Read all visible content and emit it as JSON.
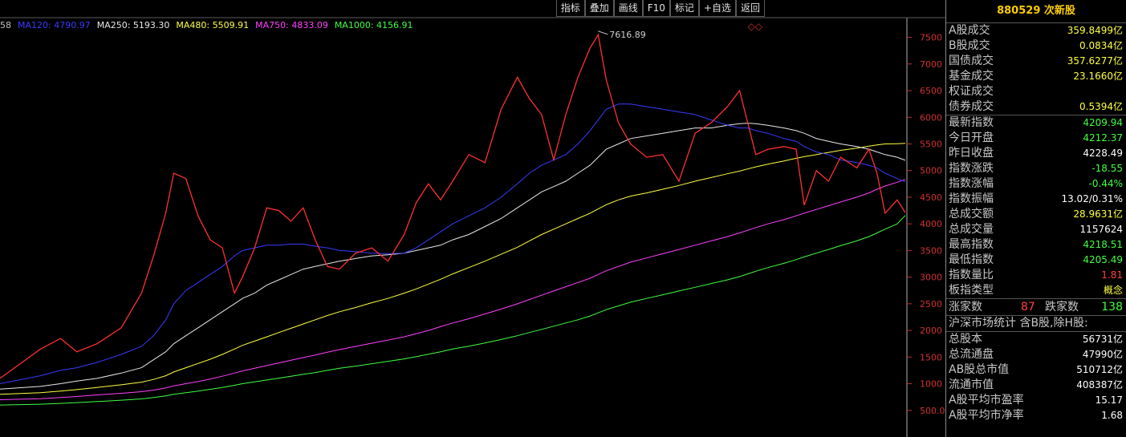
{
  "toolbar": {
    "buttons": [
      "指标",
      "叠加",
      "画线",
      "F10",
      "标记",
      "+自选",
      "返回"
    ]
  },
  "ma_legend": [
    {
      "text": "58",
      "color": "#c0c0c0"
    },
    {
      "text": "MA120: 4790.97",
      "color": "#3a3aff"
    },
    {
      "text": "MA250: 5193.30",
      "color": "#e8e8e8"
    },
    {
      "text": "MA480: 5509.91",
      "color": "#ffff40"
    },
    {
      "text": "MA750: 4833.09",
      "color": "#ff40ff"
    },
    {
      "text": "MA1000: 4156.91",
      "color": "#40ff40"
    }
  ],
  "panel": {
    "title": "880529 次新股",
    "rows_a": [
      {
        "label": "A股成交",
        "value": "359.8499亿",
        "color": "#ffff40"
      },
      {
        "label": "B股成交",
        "value": "0.0834亿",
        "color": "#ffff40"
      },
      {
        "label": "国债成交",
        "value": "357.6277亿",
        "color": "#ffff40"
      },
      {
        "label": "基金成交",
        "value": "23.1660亿",
        "color": "#ffff40"
      },
      {
        "label": "权证成交",
        "value": "",
        "color": "#ffff40"
      },
      {
        "label": "债券成交",
        "value": "0.5394亿",
        "color": "#ffff40"
      }
    ],
    "rows_b": [
      {
        "label": "最新指数",
        "value": "4209.94",
        "color": "#40ff40"
      },
      {
        "label": "今日开盘",
        "value": "4212.37",
        "color": "#40ff40"
      },
      {
        "label": "昨日收盘",
        "value": "4228.49",
        "color": "#ffffff"
      },
      {
        "label": "指数涨跌",
        "value": "-18.55",
        "color": "#40ff40"
      },
      {
        "label": "指数涨幅",
        "value": "-0.44%",
        "color": "#40ff40"
      },
      {
        "label": "指数振幅",
        "value": "13.02/0.31%",
        "color": "#ffffff"
      },
      {
        "label": "总成交额",
        "value": "28.9631亿",
        "color": "#ffff40"
      },
      {
        "label": "总成交量",
        "value": "1157624",
        "color": "#ffffff"
      },
      {
        "label": "最高指数",
        "value": "4218.51",
        "color": "#40ff40"
      },
      {
        "label": "最低指数",
        "value": "4205.49",
        "color": "#40ff40"
      },
      {
        "label": "指数量比",
        "value": "1.81",
        "color": "#ff4040"
      },
      {
        "label": "板指类型",
        "value": "概念",
        "color": "#ffff40"
      }
    ],
    "stats": {
      "up_label": "涨家数",
      "up_value": "87",
      "down_label": "跌家数",
      "down_value": "138"
    },
    "scope_label": "沪深市场统计 含B股,除H股:",
    "rows_c": [
      {
        "label": "总股本",
        "value": "56731亿",
        "color": "#ffffff"
      },
      {
        "label": "总流通盘",
        "value": "47990亿",
        "color": "#ffffff"
      },
      {
        "label": "AB股总市值",
        "value": "510712亿",
        "color": "#ffffff"
      },
      {
        "label": "流通市值",
        "value": "408387亿",
        "color": "#ffffff"
      },
      {
        "label": "A股平均市盈率",
        "value": "15.17",
        "color": "#ffffff"
      },
      {
        "label": "A股平均市净率",
        "value": "1.68",
        "color": "#ffffff"
      }
    ]
  },
  "chart_data": {
    "type": "line",
    "ylim": [
      0,
      7900
    ],
    "y_ticks": [
      500,
      1000,
      1500,
      2000,
      2500,
      3000,
      3500,
      4000,
      4500,
      5000,
      5500,
      6000,
      6500,
      7000,
      7500
    ],
    "y_tick_labels": [
      "500.0",
      "1000",
      "1500",
      "2000",
      "2500",
      "3000",
      "3500",
      "4000",
      "4500",
      "5000",
      "5500",
      "6000",
      "6500",
      "7000",
      "7500"
    ],
    "peak_label": "7616.89",
    "peak_value": 7616.89,
    "x": [
      0,
      50,
      75,
      95,
      120,
      150,
      175,
      190,
      205,
      215,
      230,
      245,
      260,
      275,
      290,
      300,
      315,
      330,
      345,
      360,
      375,
      390,
      405,
      420,
      440,
      460,
      480,
      500,
      515,
      530,
      545,
      560,
      580,
      600,
      620,
      640,
      655,
      670,
      685,
      700,
      715,
      730,
      740,
      750,
      765,
      780,
      800,
      820,
      840,
      860,
      880,
      900,
      915,
      925,
      935,
      950,
      970,
      985,
      995,
      1010,
      1025,
      1040,
      1060,
      1075,
      1085,
      1095,
      1110,
      1120
    ],
    "series": [
      {
        "name": "close",
        "color": "#ff3030",
        "values": [
          1100,
          1650,
          1850,
          1600,
          1750,
          2050,
          2700,
          3400,
          4200,
          4950,
          4850,
          4150,
          3700,
          3550,
          2700,
          3000,
          3550,
          4300,
          4250,
          4050,
          4300,
          3700,
          3200,
          3150,
          3450,
          3550,
          3300,
          3800,
          4400,
          4750,
          4450,
          4800,
          5300,
          5150,
          6150,
          6750,
          6350,
          6050,
          5200,
          6050,
          6750,
          7300,
          7550,
          6700,
          5900,
          5500,
          5250,
          5300,
          4800,
          5700,
          5900,
          6200,
          6500,
          5900,
          5300,
          5400,
          5450,
          5400,
          4350,
          5000,
          4800,
          5250,
          5050,
          5400,
          4950,
          4200,
          4450,
          4210
        ]
      },
      {
        "name": "MA120",
        "color": "#3a3aff",
        "values": [
          1000,
          1150,
          1250,
          1300,
          1400,
          1550,
          1700,
          1900,
          2200,
          2500,
          2750,
          2900,
          3050,
          3200,
          3400,
          3500,
          3550,
          3600,
          3600,
          3620,
          3620,
          3580,
          3550,
          3500,
          3480,
          3450,
          3440,
          3450,
          3550,
          3700,
          3850,
          4000,
          4150,
          4300,
          4500,
          4750,
          4950,
          5100,
          5200,
          5300,
          5500,
          5750,
          5950,
          6150,
          6250,
          6250,
          6200,
          6150,
          6100,
          6050,
          5950,
          5850,
          5800,
          5800,
          5750,
          5700,
          5600,
          5550,
          5450,
          5350,
          5300,
          5200,
          5150,
          5100,
          5050,
          4950,
          4850,
          4790.97
        ]
      },
      {
        "name": "MA250",
        "color": "#e8e8e8",
        "values": [
          900,
          950,
          1000,
          1050,
          1100,
          1200,
          1300,
          1450,
          1600,
          1750,
          1900,
          2050,
          2200,
          2350,
          2500,
          2600,
          2700,
          2850,
          2950,
          3050,
          3150,
          3200,
          3250,
          3300,
          3350,
          3400,
          3420,
          3450,
          3500,
          3550,
          3600,
          3700,
          3800,
          3950,
          4100,
          4300,
          4450,
          4600,
          4700,
          4800,
          4950,
          5100,
          5250,
          5400,
          5500,
          5600,
          5650,
          5700,
          5750,
          5800,
          5800,
          5850,
          5880,
          5890,
          5880,
          5850,
          5800,
          5750,
          5700,
          5600,
          5550,
          5500,
          5450,
          5400,
          5350,
          5300,
          5250,
          5193.3
        ]
      },
      {
        "name": "MA480",
        "color": "#ffff40",
        "values": [
          800,
          830,
          860,
          890,
          930,
          980,
          1030,
          1080,
          1150,
          1220,
          1300,
          1380,
          1460,
          1550,
          1650,
          1720,
          1800,
          1880,
          1960,
          2040,
          2120,
          2200,
          2280,
          2350,
          2430,
          2520,
          2600,
          2700,
          2780,
          2870,
          2960,
          3060,
          3180,
          3300,
          3430,
          3560,
          3680,
          3800,
          3900,
          4000,
          4100,
          4200,
          4280,
          4360,
          4450,
          4520,
          4580,
          4650,
          4720,
          4800,
          4870,
          4940,
          4990,
          5030,
          5070,
          5120,
          5180,
          5230,
          5260,
          5300,
          5340,
          5380,
          5420,
          5460,
          5480,
          5500,
          5505,
          5509.91
        ]
      },
      {
        "name": "MA750",
        "color": "#ff40ff",
        "values": [
          700,
          720,
          740,
          760,
          790,
          820,
          850,
          880,
          920,
          960,
          1000,
          1040,
          1090,
          1140,
          1200,
          1240,
          1290,
          1340,
          1390,
          1440,
          1490,
          1540,
          1590,
          1640,
          1700,
          1760,
          1820,
          1880,
          1940,
          2000,
          2070,
          2140,
          2220,
          2310,
          2400,
          2500,
          2580,
          2660,
          2740,
          2820,
          2900,
          2980,
          3050,
          3120,
          3200,
          3280,
          3360,
          3440,
          3520,
          3600,
          3680,
          3760,
          3830,
          3880,
          3930,
          4000,
          4080,
          4150,
          4200,
          4270,
          4340,
          4410,
          4500,
          4580,
          4650,
          4710,
          4780,
          4833.09
        ]
      },
      {
        "name": "MA1000",
        "color": "#40ff40",
        "values": [
          600,
          615,
          630,
          645,
          665,
          690,
          715,
          740,
          770,
          800,
          830,
          860,
          895,
          930,
          970,
          1000,
          1035,
          1070,
          1105,
          1140,
          1175,
          1210,
          1250,
          1290,
          1330,
          1375,
          1420,
          1465,
          1510,
          1555,
          1600,
          1650,
          1705,
          1765,
          1830,
          1900,
          1960,
          2020,
          2080,
          2140,
          2200,
          2270,
          2330,
          2390,
          2460,
          2530,
          2600,
          2670,
          2740,
          2810,
          2880,
          2950,
          3010,
          3060,
          3110,
          3180,
          3260,
          3330,
          3380,
          3450,
          3520,
          3590,
          3680,
          3760,
          3830,
          3900,
          4000,
          4156.91
        ]
      }
    ]
  }
}
